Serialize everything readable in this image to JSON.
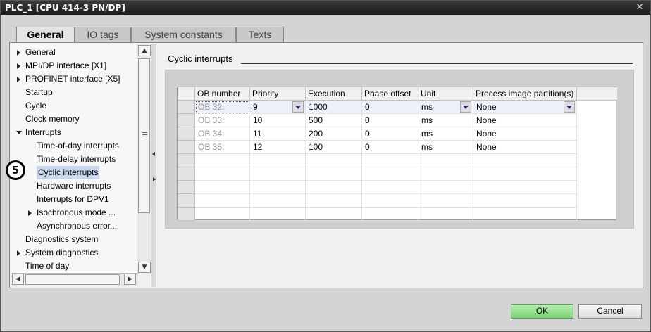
{
  "window": {
    "title": "PLC_1 [CPU 414-3 PN/DP]",
    "close_glyph": "✕"
  },
  "tabs": [
    "General",
    "IO tags",
    "System constants",
    "Texts"
  ],
  "tree": {
    "items": [
      {
        "label": "General",
        "arrow": "right"
      },
      {
        "label": "MPI/DP interface [X1]",
        "arrow": "right"
      },
      {
        "label": "PROFINET interface [X5]",
        "arrow": "right"
      },
      {
        "label": "Startup",
        "arrow": ""
      },
      {
        "label": "Cycle",
        "arrow": ""
      },
      {
        "label": "Clock memory",
        "arrow": ""
      },
      {
        "label": "Interrupts",
        "arrow": "down"
      },
      {
        "label": "Time-of-day interrupts",
        "arrow": ""
      },
      {
        "label": "Time-delay interrupts",
        "arrow": ""
      },
      {
        "label": "Cyclic interrupts",
        "arrow": "",
        "selected": true
      },
      {
        "label": "Hardware interrupts",
        "arrow": ""
      },
      {
        "label": "Interrupts for DPV1",
        "arrow": ""
      },
      {
        "label": "Isochronous mode ...",
        "arrow": "right"
      },
      {
        "label": "Asynchronous error...",
        "arrow": ""
      },
      {
        "label": "Diagnostics system",
        "arrow": ""
      },
      {
        "label": "System diagnostics",
        "arrow": "right"
      },
      {
        "label": "Time of day",
        "arrow": ""
      }
    ]
  },
  "badge": "5",
  "section": {
    "title": "Cyclic interrupts"
  },
  "table": {
    "columns": [
      "OB number",
      "Priority",
      "Execution",
      "Phase offset",
      "Unit",
      "Process image partition(s)"
    ],
    "rows": [
      [
        "OB 32:",
        "9",
        "1000",
        "0",
        "ms",
        "None"
      ],
      [
        "OB 33:",
        "10",
        "500",
        "0",
        "ms",
        "None"
      ],
      [
        "OB 34:",
        "11",
        "200",
        "0",
        "ms",
        "None"
      ],
      [
        "OB 35:",
        "12",
        "100",
        "0",
        "ms",
        "None"
      ]
    ],
    "empty_rows": 5
  },
  "buttons": {
    "ok": "OK",
    "cancel": "Cancel"
  },
  "colors": {
    "ok_button": "#7bd275",
    "selection": "#c5d5ea",
    "titlebar": "#1c1c1c"
  }
}
